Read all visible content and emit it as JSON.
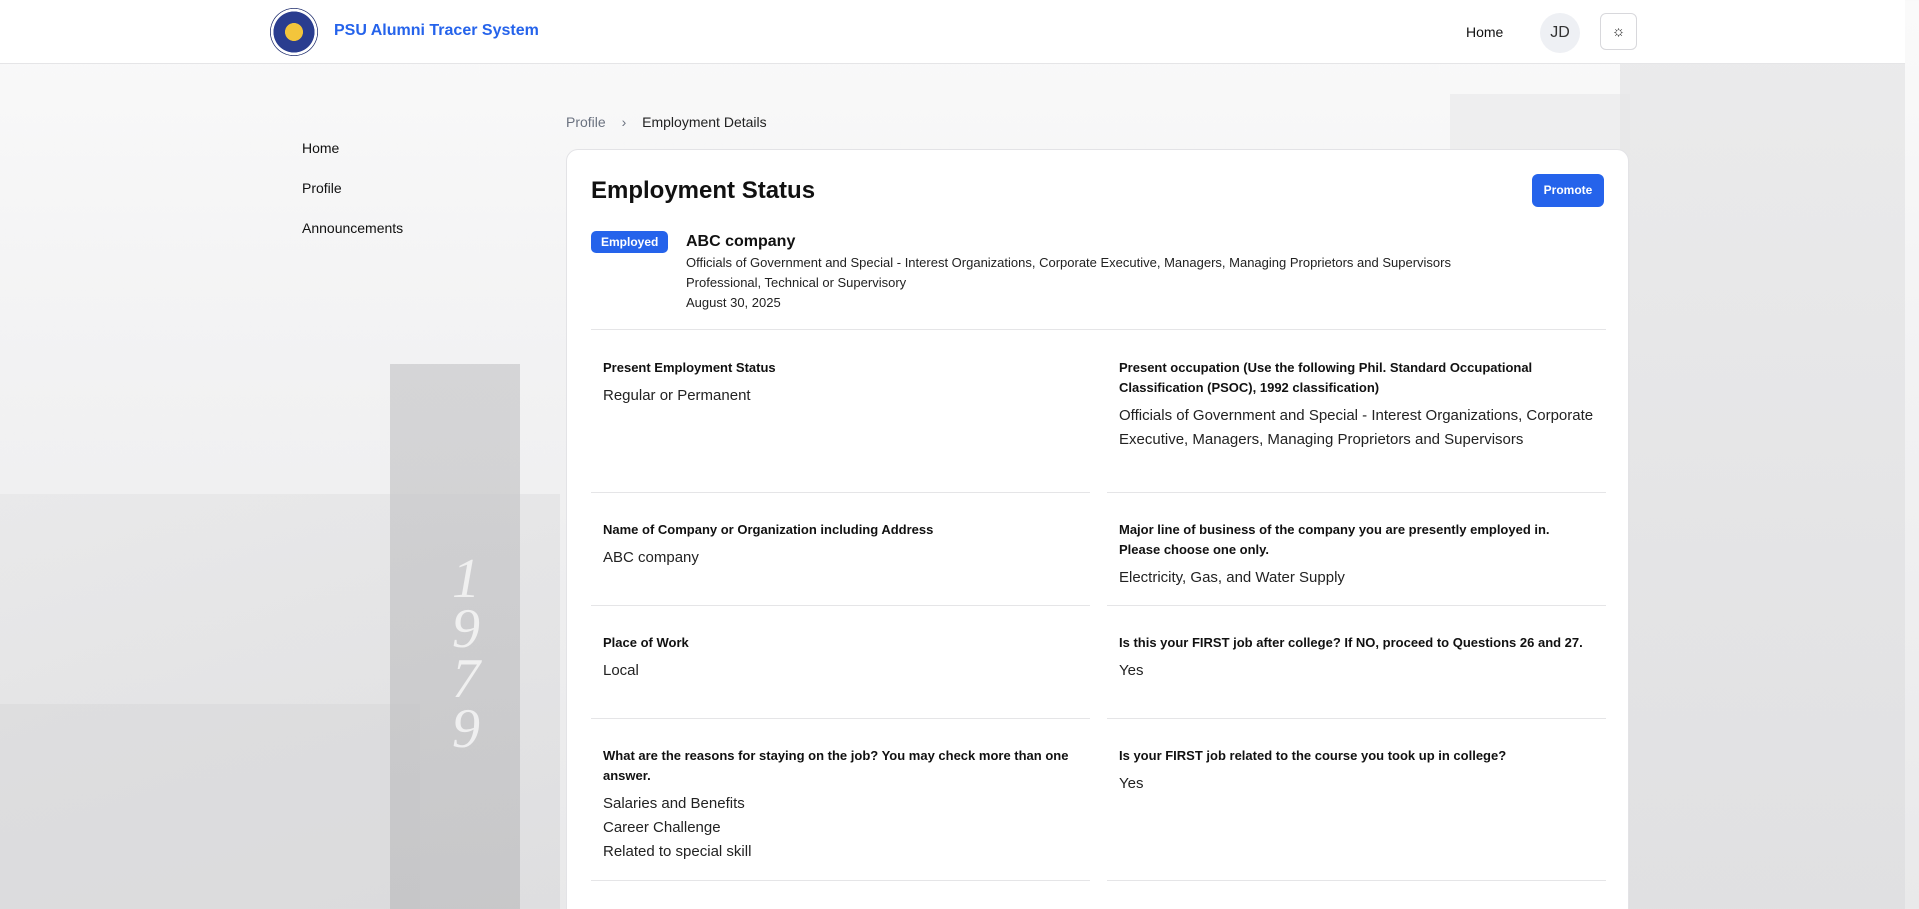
{
  "header": {
    "brand": "PSU Alumni Tracer System",
    "nav_home": "Home",
    "avatar_initials": "JD",
    "theme_icon": "sun-icon"
  },
  "sidebar": {
    "items": [
      {
        "label": "Home"
      },
      {
        "label": "Profile"
      },
      {
        "label": "Announcements"
      }
    ]
  },
  "breadcrumb": {
    "items": [
      "Profile",
      "Employment Details"
    ],
    "separator": "›"
  },
  "card": {
    "title": "Employment Status",
    "promote_label": "Promote",
    "summary": {
      "badge": "Employed",
      "company": "ABC company",
      "occupation": "Officials of Government and Special - Interest Organizations, Corporate Executive, Managers, Managing Proprietors and Supervisors",
      "job_level": "Professional, Technical or Supervisory",
      "date": "August 30, 2025"
    },
    "fields": [
      {
        "question": "Present Employment Status",
        "answers": [
          "Regular or Permanent"
        ]
      },
      {
        "question": "Present occupation (Use the following Phil. Standard Occupational Classification (PSOC), 1992 classification)",
        "answers": [
          "Officials of Government and Special - Interest Organizations, Corporate Executive, Managers, Managing Proprietors and Supervisors"
        ]
      },
      {
        "question": "Name of Company or Organization including Address",
        "answers": [
          "ABC company"
        ]
      },
      {
        "question": "Major line of business of the company you are presently employed in. Please choose one only.",
        "answers": [
          "Electricity, Gas, and Water Supply"
        ]
      },
      {
        "question": "Place of Work",
        "answers": [
          "Local"
        ]
      },
      {
        "question": "Is this your FIRST job after college? If NO, proceed to Questions 26 and 27.",
        "answers": [
          "Yes"
        ]
      },
      {
        "question": "What are the reasons for staying on the job? You may check more than one answer.",
        "answers": [
          "Salaries and Benefits",
          "Career Challenge",
          "Related to special skill"
        ]
      },
      {
        "question": "Is your FIRST job related to the course you took up in college?",
        "answers": [
          "Yes"
        ]
      }
    ]
  },
  "background": {
    "building_number": "1979"
  },
  "colors": {
    "accent": "#2563eb",
    "border": "#e5e5e7",
    "muted": "#6b7280"
  }
}
